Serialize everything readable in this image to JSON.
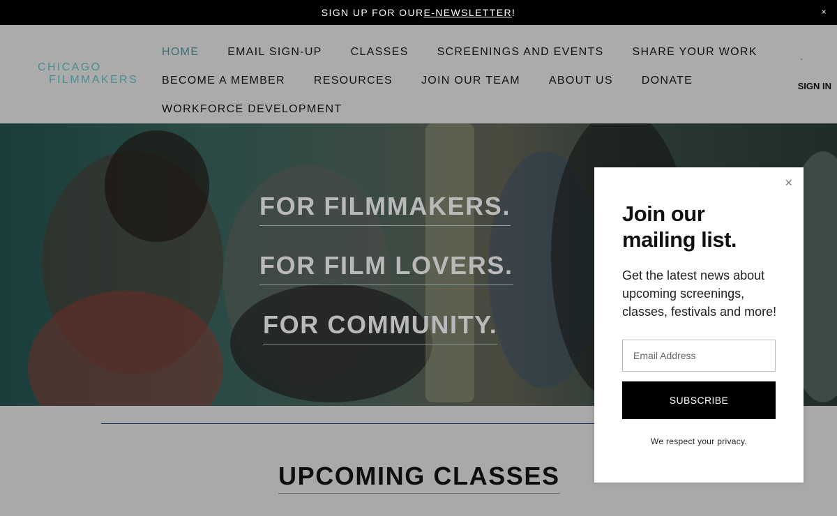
{
  "announcement": {
    "text_before": "SIGN UP FOR OUR ",
    "link": "E-NEWSLETTER",
    "text_after": "!",
    "close": "×"
  },
  "header": {
    "logo_line1": "CHICAGO",
    "logo_line2": "FILMMAKERS",
    "nav": {
      "home": "HOME",
      "email_signup": "EMAIL SIGN-UP",
      "classes": "CLASSES",
      "screenings": "SCREENINGS AND EVENTS",
      "share": "SHARE YOUR WORK",
      "member": "BECOME A MEMBER",
      "resources": "RESOURCES",
      "join_team": "JOIN OUR TEAM",
      "about": "ABOUT US",
      "donate": "DONATE",
      "workforce": "WORKFORCE DEVELOPMENT"
    },
    "sign_in": "SIGN IN"
  },
  "hero": {
    "tagline1": "FOR FILMMAKERS.",
    "tagline2": "FOR FILM LOVERS.",
    "tagline3": "FOR COMMUNITY."
  },
  "section": {
    "heading": "UPCOMING CLASSES"
  },
  "popup": {
    "close": "×",
    "title": "Join our mailing list.",
    "description": "Get the latest news about upcoming screenings, classes, festivals and more!",
    "email_placeholder": "Email Address",
    "subscribe": "SUBSCRIBE",
    "privacy": "We respect your privacy."
  }
}
